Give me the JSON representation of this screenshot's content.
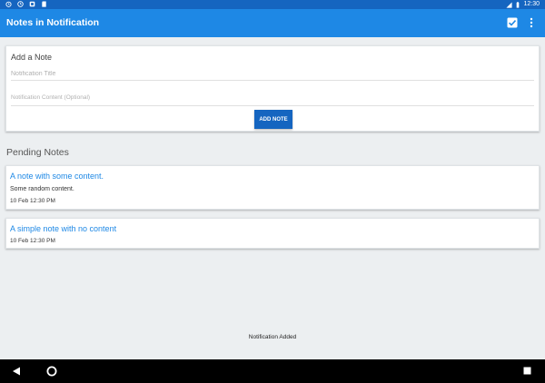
{
  "status_bar": {
    "time": "12:30"
  },
  "app_bar": {
    "title": "Notes in Notification"
  },
  "add_note": {
    "heading": "Add a Note",
    "title_placeholder": "Notification Title",
    "content_placeholder": "Notification Content (Optional)",
    "button_label": "ADD NOTE"
  },
  "pending": {
    "heading": "Pending Notes",
    "notes": [
      {
        "title": "A note with some content.",
        "content": "Some random content.",
        "time": "10 Feb 12:30 PM"
      },
      {
        "title": "A simple note with no content",
        "time": "10 Feb 12:30 PM"
      }
    ]
  },
  "toast": {
    "message": "Notification Added"
  },
  "colors": {
    "status_bar": "#1565c0",
    "app_bar": "#1e88e5",
    "button": "#1565c0",
    "note_title": "#1e88e5"
  }
}
